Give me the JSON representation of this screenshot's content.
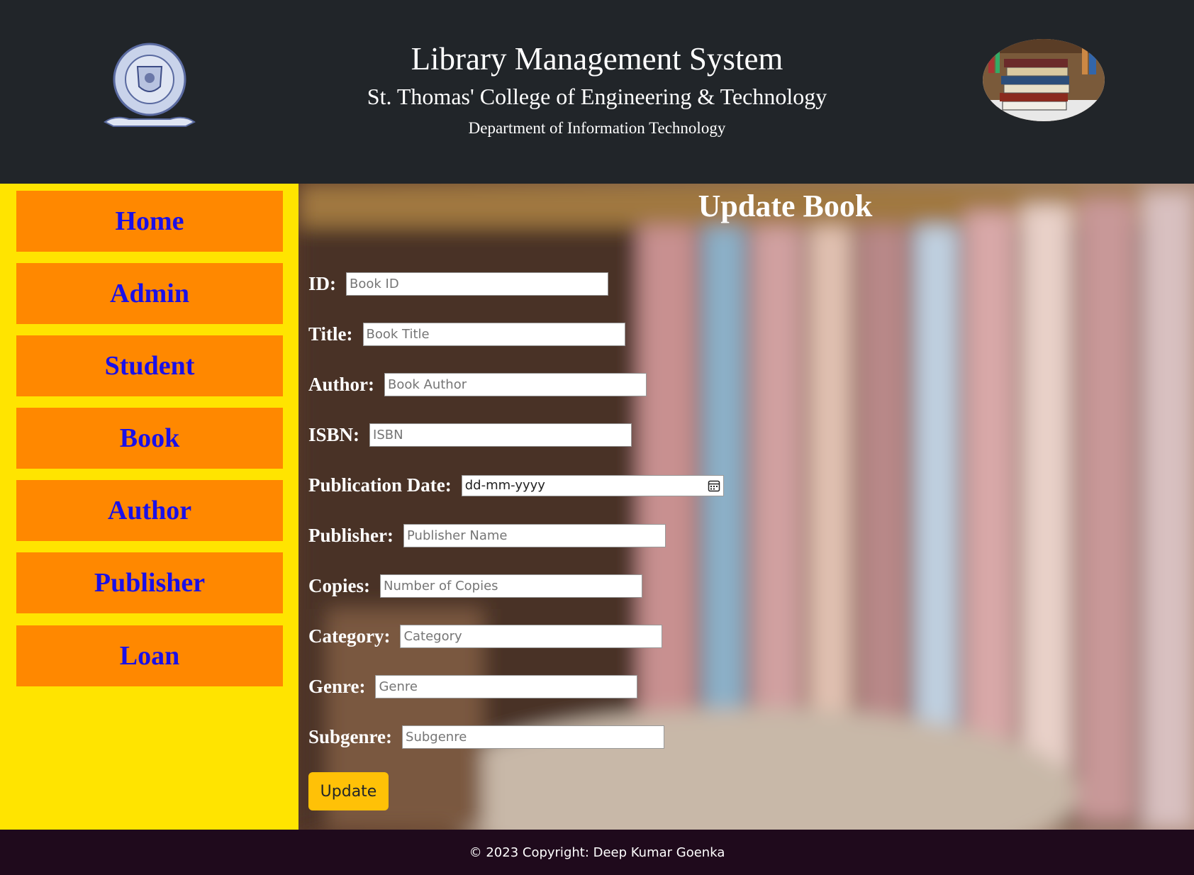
{
  "header": {
    "title": "Library Management System",
    "college": "St. Thomas' College of Engineering & Technology",
    "department": "Department of Information Technology",
    "logo_icon": "college-crest-icon",
    "books_image": "book-stack-image"
  },
  "sidebar": {
    "items": [
      {
        "label": "Home"
      },
      {
        "label": "Admin"
      },
      {
        "label": "Student"
      },
      {
        "label": "Book"
      },
      {
        "label": "Author"
      },
      {
        "label": "Publisher"
      },
      {
        "label": "Loan"
      }
    ]
  },
  "form": {
    "heading": "Update Book",
    "fields": [
      {
        "label": "ID:",
        "placeholder": "Book ID"
      },
      {
        "label": "Title:",
        "placeholder": "Book Title"
      },
      {
        "label": "Author:",
        "placeholder": "Book Author"
      },
      {
        "label": "ISBN:",
        "placeholder": "ISBN"
      },
      {
        "label": "Publication Date:",
        "value": "dd-mm-yyyy"
      },
      {
        "label": "Publisher:",
        "placeholder": "Publisher Name"
      },
      {
        "label": "Copies:",
        "placeholder": "Number of Copies"
      },
      {
        "label": "Category:",
        "placeholder": "Category"
      },
      {
        "label": "Genre:",
        "placeholder": "Genre"
      },
      {
        "label": "Subgenre:",
        "placeholder": "Subgenre"
      }
    ],
    "submit_label": "Update"
  },
  "footer": {
    "copyright": "© 2023 Copyright: Deep Kumar Goenka"
  },
  "colors": {
    "header_bg": "#212529",
    "sidebar_bg": "#ffe400",
    "nav_bg": "#ff8800",
    "nav_text": "#1a10e8",
    "button_bg": "#ffc107",
    "footer_bg": "#1f0a1c"
  }
}
